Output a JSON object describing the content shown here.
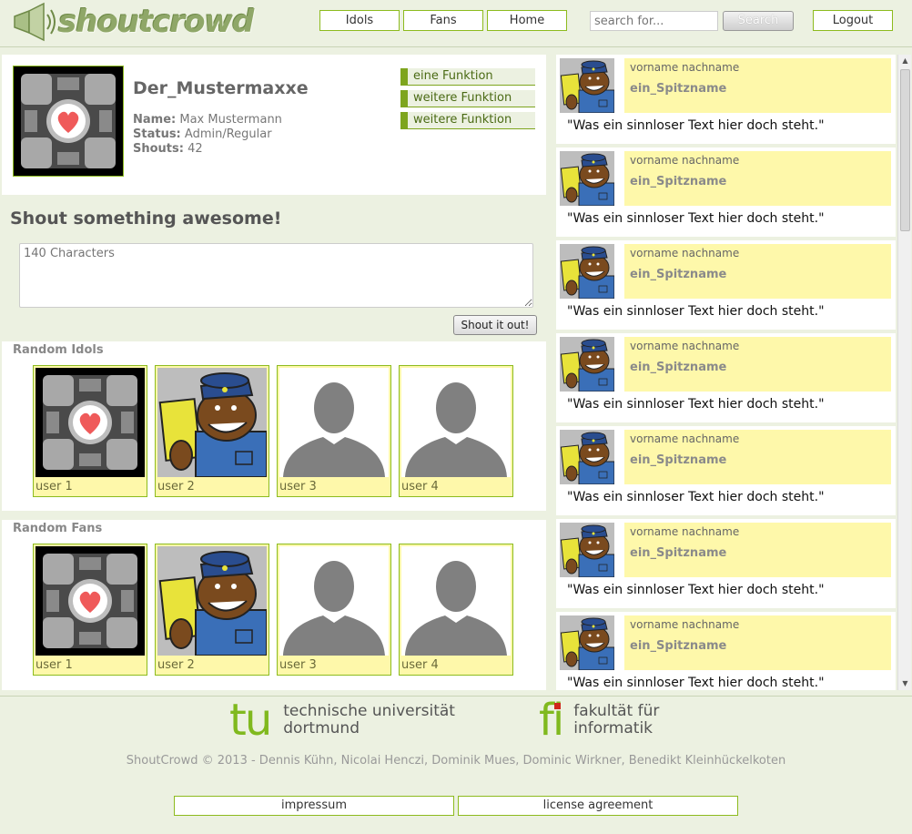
{
  "header": {
    "logo_text": "shoutcrowd",
    "nav": [
      "Idols",
      "Fans",
      "Home"
    ],
    "search_placeholder": "search for...",
    "search_label": "Search",
    "logout_label": "Logout"
  },
  "profile": {
    "username": "Der_Mustermaxxe",
    "name_label": "Name:",
    "name_value": "Max Mustermann",
    "status_label": "Status:",
    "status_value": "Admin/Regular",
    "shouts_label": "Shouts:",
    "shouts_value": "42",
    "functions": [
      "eine Funktion",
      "weitere Funktion",
      "weitere Funktion"
    ]
  },
  "shout": {
    "title": "Shout something awesome!",
    "placeholder": "140 Characters",
    "button": "Shout it out!"
  },
  "random_idols": {
    "label": "Random Idols",
    "users": [
      "user 1",
      "user 2",
      "user 3",
      "user 4"
    ],
    "avatar_icons": [
      "companion-cube-icon",
      "bear-police-icon",
      "default-user-icon",
      "default-user-icon"
    ]
  },
  "random_fans": {
    "label": "Random Fans",
    "users": [
      "user 1",
      "user 2",
      "user 3",
      "user 4"
    ],
    "avatar_icons": [
      "companion-cube-icon",
      "bear-police-icon",
      "default-user-icon",
      "default-user-icon"
    ]
  },
  "feed": [
    {
      "fullname": "vorname nachname",
      "nick": "ein_Spitzname",
      "message": "\"Was ein sinnloser Text hier doch steht.\""
    },
    {
      "fullname": "vorname nachname",
      "nick": "ein_Spitzname",
      "message": "\"Was ein sinnloser Text hier doch steht.\""
    },
    {
      "fullname": "vorname nachname",
      "nick": "ein_Spitzname",
      "message": "\"Was ein sinnloser Text hier doch steht.\""
    },
    {
      "fullname": "vorname nachname",
      "nick": "ein_Spitzname",
      "message": "\"Was ein sinnloser Text hier doch steht.\""
    },
    {
      "fullname": "vorname nachname",
      "nick": "ein_Spitzname",
      "message": "\"Was ein sinnloser Text hier doch steht.\""
    },
    {
      "fullname": "vorname nachname",
      "nick": "ein_Spitzname",
      "message": "\"Was ein sinnloser Text hier doch steht.\""
    },
    {
      "fullname": "vorname nachname",
      "nick": "ein_Spitzname",
      "message": "\"Was ein sinnloser Text hier doch steht.\""
    }
  ],
  "footer": {
    "tu_mark": "tu",
    "tu_line1": "technische universität",
    "tu_line2": "dortmund",
    "fi_mark": "fi",
    "fi_line1": "fakultät für",
    "fi_line2": "informatik",
    "copyright": "ShoutCrowd © 2013 - Dennis Kühn, Nicolai Henczi, Dominik Mues, Dominic Wirkner, Benedikt Kleinhückelkoten",
    "links": [
      "impressum",
      "license agreement"
    ]
  },
  "colors": {
    "accent_green": "#8dbb1e",
    "card_yellow": "#fef8aa",
    "page_bg": "#ecf1e1"
  }
}
